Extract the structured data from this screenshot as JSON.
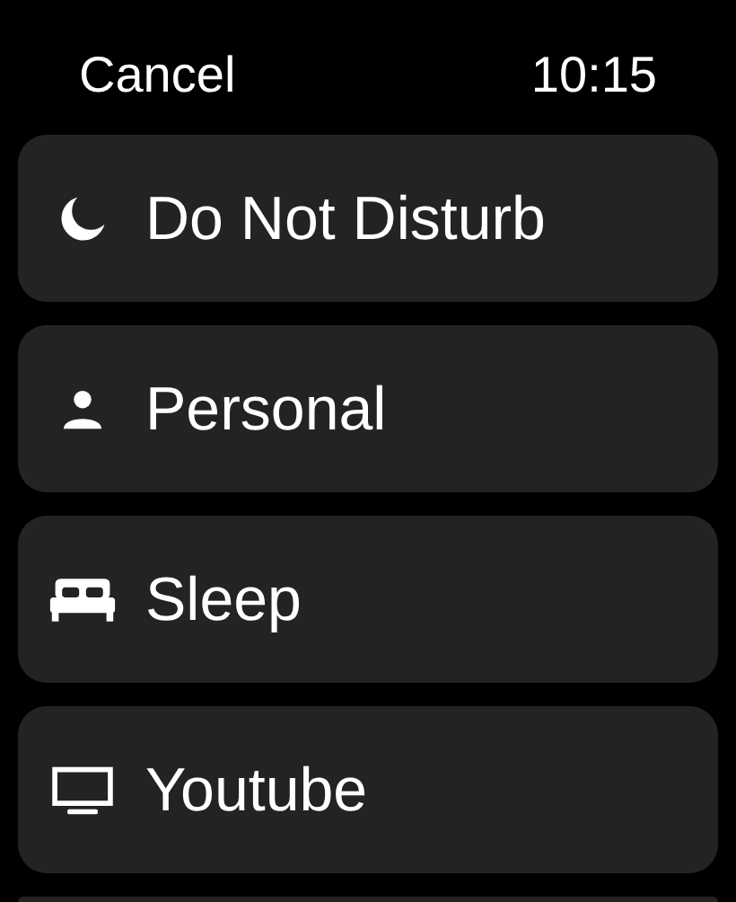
{
  "header": {
    "cancel": "Cancel",
    "time": "10:15"
  },
  "focus_modes": [
    {
      "label": "Do Not Disturb"
    },
    {
      "label": "Personal"
    },
    {
      "label": "Sleep"
    },
    {
      "label": "Youtube"
    }
  ]
}
